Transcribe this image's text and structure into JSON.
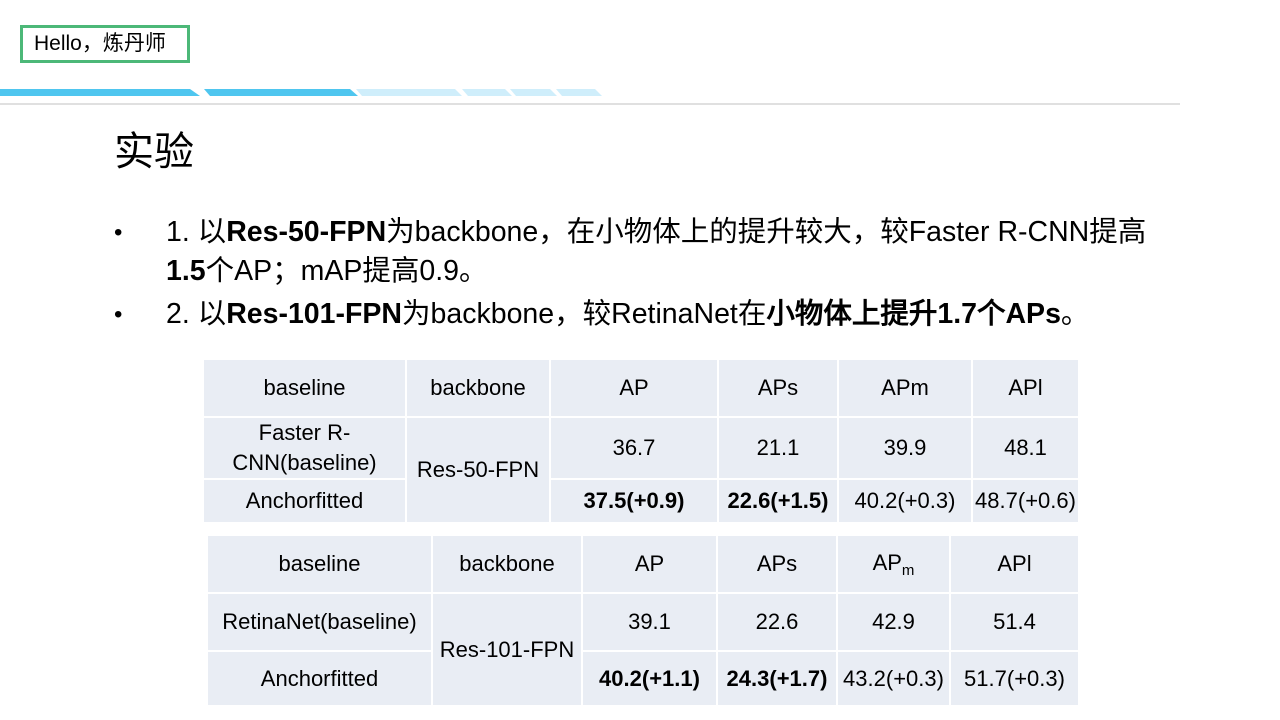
{
  "greeting": "Hello，炼丹师",
  "slide_title": "实验",
  "bullet_marker": "•",
  "bullets": [
    {
      "p1": "1. 以",
      "b1": "Res-50-FPN",
      "p2": "为backbone，在小物体上的提升较大，较Faster R-CNN提高",
      "b2": "1.5",
      "p3": "个AP；mAP提高0.9。"
    },
    {
      "p1": "2. 以",
      "b1": "Res-101-FPN",
      "p2": "为backbone，较RetinaNet在",
      "b2": "小物体上提升1.7个APs",
      "p3": "。"
    }
  ],
  "table1": {
    "headers": [
      "baseline",
      "backbone",
      "AP",
      "APs",
      "APm",
      "APl"
    ],
    "rows": [
      {
        "baseline": "Faster R-CNN(baseline)",
        "backbone": "Res-50-FPN",
        "ap": "36.7",
        "aps": "21.1",
        "apm": "39.9",
        "apl": "48.1"
      },
      {
        "baseline": "Anchorfitted",
        "ap": "37.5(+0.9)",
        "aps": "22.6(+1.5)",
        "apm": "40.2(+0.3)",
        "apl": "48.7(+0.6)"
      }
    ]
  },
  "table2": {
    "headers": [
      "baseline",
      "backbone",
      "AP",
      "APs",
      "AP",
      "m",
      "APl"
    ],
    "rows": [
      {
        "baseline": "RetinaNet(baseline)",
        "backbone": "Res-101-FPN",
        "ap": "39.1",
        "aps": "22.6",
        "apm": "42.9",
        "apl": "51.4"
      },
      {
        "baseline": "Anchorfitted",
        "ap": "40.2(+1.1)",
        "aps": "24.3(+1.7)",
        "apm": "43.2(+0.3)",
        "apl": "51.7(+0.3)"
      }
    ]
  }
}
